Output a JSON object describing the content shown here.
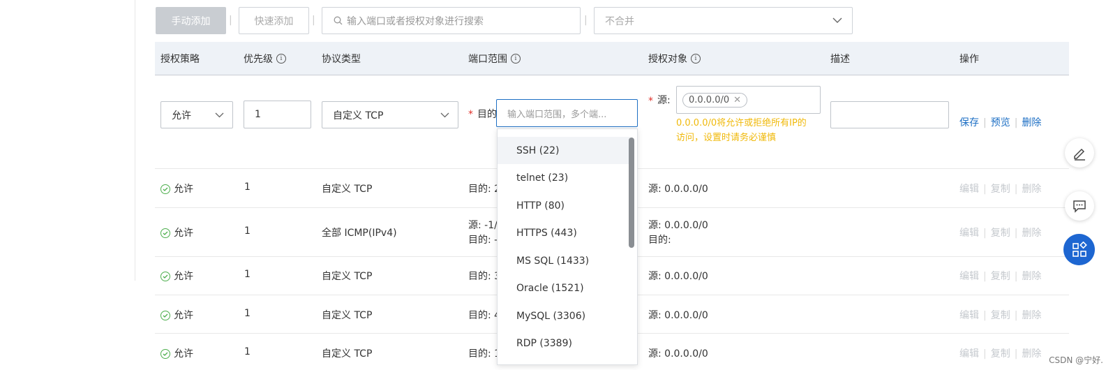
{
  "toolbar": {
    "manual_add": "手动添加",
    "separator": "|",
    "quick_add": "快速添加",
    "search_placeholder": "输入端口或者授权对象进行搜索",
    "merge_select": "不合并"
  },
  "columns": {
    "policy": "授权策略",
    "priority": "优先级",
    "protocol": "协议类型",
    "port_range": "端口范围",
    "auth_object": "授权对象",
    "description": "描述",
    "actions": "操作"
  },
  "edit_row": {
    "policy": "允许",
    "priority": "1",
    "protocol": "自定义 TCP",
    "dest_label": "目的",
    "port_placeholder": "输入端口范围，多个端...",
    "source_label": "源:",
    "source_tag": "0.0.0.0/0",
    "warning_line1": "0.0.0.0/0将允许或拒绝所有IP的",
    "warning_line2": "访问，设置时请务必谨慎",
    "save": "保存",
    "preview": "预览",
    "delete": "删除"
  },
  "rows": [
    {
      "policy": "允许",
      "priority": "1",
      "protocol": "自定义 TCP",
      "port": "目的: 2",
      "port2": "",
      "source": "源: 0.0.0.0/0",
      "source2": ""
    },
    {
      "policy": "允许",
      "priority": "1",
      "protocol": "全部 ICMP(IPv4)",
      "port": "源: -1/",
      "port2": "目的: -",
      "source": "源: 0.0.0.0/0",
      "source2": "目的:"
    },
    {
      "policy": "允许",
      "priority": "1",
      "protocol": "自定义 TCP",
      "port": "目的: 3",
      "port2": "",
      "source": "源: 0.0.0.0/0",
      "source2": ""
    },
    {
      "policy": "允许",
      "priority": "1",
      "protocol": "自定义 TCP",
      "port": "目的: 4",
      "port2": "",
      "source": "源: 0.0.0.0/0",
      "source2": ""
    },
    {
      "policy": "允许",
      "priority": "1",
      "protocol": "自定义 TCP",
      "port": "目的: 1",
      "port2": "",
      "source": "源: 0.0.0.0/0",
      "source2": ""
    }
  ],
  "row_actions": {
    "edit": "编辑",
    "copy": "复制",
    "delete": "删除"
  },
  "dropdown": {
    "options": [
      "SSH (22)",
      "telnet (23)",
      "HTTP (80)",
      "HTTPS (443)",
      "MS SQL (1433)",
      "Oracle (1521)",
      "MySQL (3306)",
      "RDP (3389)"
    ]
  },
  "watermark": "CSDN @宁好.",
  "colors": {
    "link": "#1d6fc4",
    "warning": "#f0b90b",
    "required": "#e0302a",
    "success": "#4cae4c",
    "fab_blue": "#1d66d1"
  }
}
